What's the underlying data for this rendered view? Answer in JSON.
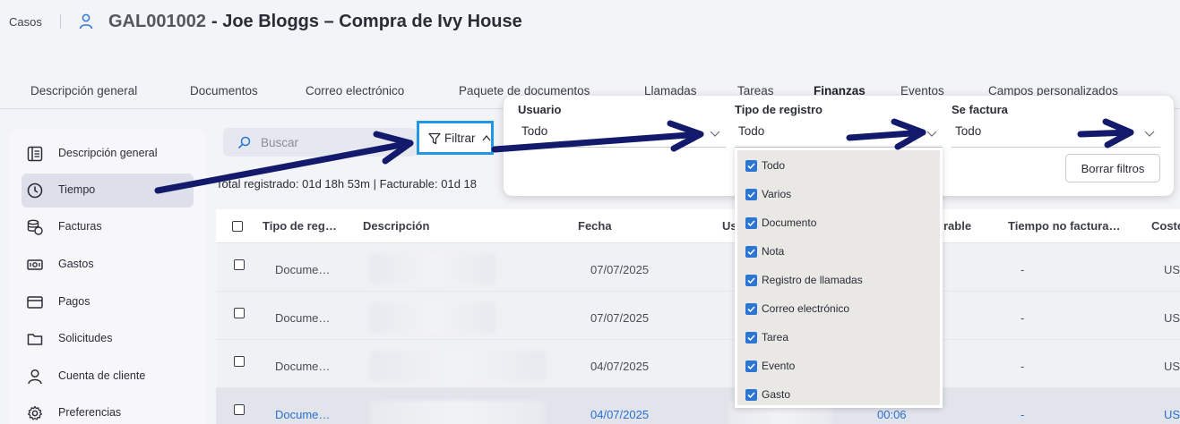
{
  "header": {
    "breadcrumb": "Casos",
    "case_id": "GAL001002",
    "case_title": "- Joe Bloggs – Compra de Ivy House"
  },
  "tabs": [
    {
      "label": "Descripción general"
    },
    {
      "label": "Documentos"
    },
    {
      "label": "Correo electrónico"
    },
    {
      "label": "Paquete de documentos"
    },
    {
      "label": "Llamadas"
    },
    {
      "label": "Tareas"
    },
    {
      "label": "Finanzas"
    },
    {
      "label": "Eventos"
    },
    {
      "label": "Campos personalizados"
    }
  ],
  "sidebar": {
    "items": [
      {
        "label": "Descripción general",
        "icon": "overview-icon"
      },
      {
        "label": "Tiempo",
        "icon": "clock-icon"
      },
      {
        "label": "Facturas",
        "icon": "coins-icon"
      },
      {
        "label": "Gastos",
        "icon": "banknote-icon"
      },
      {
        "label": "Pagos",
        "icon": "card-icon"
      },
      {
        "label": "Solicitudes",
        "icon": "folder-icon"
      },
      {
        "label": "Cuenta de cliente",
        "icon": "person-icon"
      },
      {
        "label": "Preferencias",
        "icon": "gear-icon"
      }
    ]
  },
  "toolbar": {
    "search_placeholder": "Buscar",
    "filter_label": "Filtrar"
  },
  "totals": "Total registrado: 01d 18h 53m  |  Facturable: 01d 18",
  "table": {
    "headers": {
      "type": "Tipo de reg…",
      "description": "Descripción",
      "date": "Fecha",
      "user": "Us",
      "billable": "rable",
      "nonbillable": "Tiempo no factura…",
      "cost": "Coste"
    },
    "rows": [
      {
        "type": "Docume…",
        "date": "07/07/2025",
        "billable": "",
        "nonbillable": "-",
        "cost": "US$"
      },
      {
        "type": "Docume…",
        "date": "07/07/2025",
        "billable": "",
        "nonbillable": "-",
        "cost": "US$"
      },
      {
        "type": "Docume…",
        "date": "04/07/2025",
        "billable": "",
        "nonbillable": "-",
        "cost": "US$"
      },
      {
        "type": "Docume…",
        "date": "04/07/2025",
        "billable": "00:06",
        "nonbillable": "-",
        "cost": "US$"
      }
    ]
  },
  "filters": {
    "user": {
      "label": "Usuario",
      "value": "Todo"
    },
    "record_type": {
      "label": "Tipo de registro",
      "value": "Todo"
    },
    "invoiced": {
      "label": "Se factura",
      "value": "Todo"
    },
    "clear_label": "Borrar filtros"
  },
  "record_type_options": [
    "Todo",
    "Varios",
    "Documento",
    "Nota",
    "Registro de llamadas",
    "Correo electrónico",
    "Tarea",
    "Evento",
    "Gasto"
  ],
  "colors": {
    "accent": "#2b75d6",
    "highlight_border": "#2397e6",
    "arrow": "#131a6b"
  }
}
